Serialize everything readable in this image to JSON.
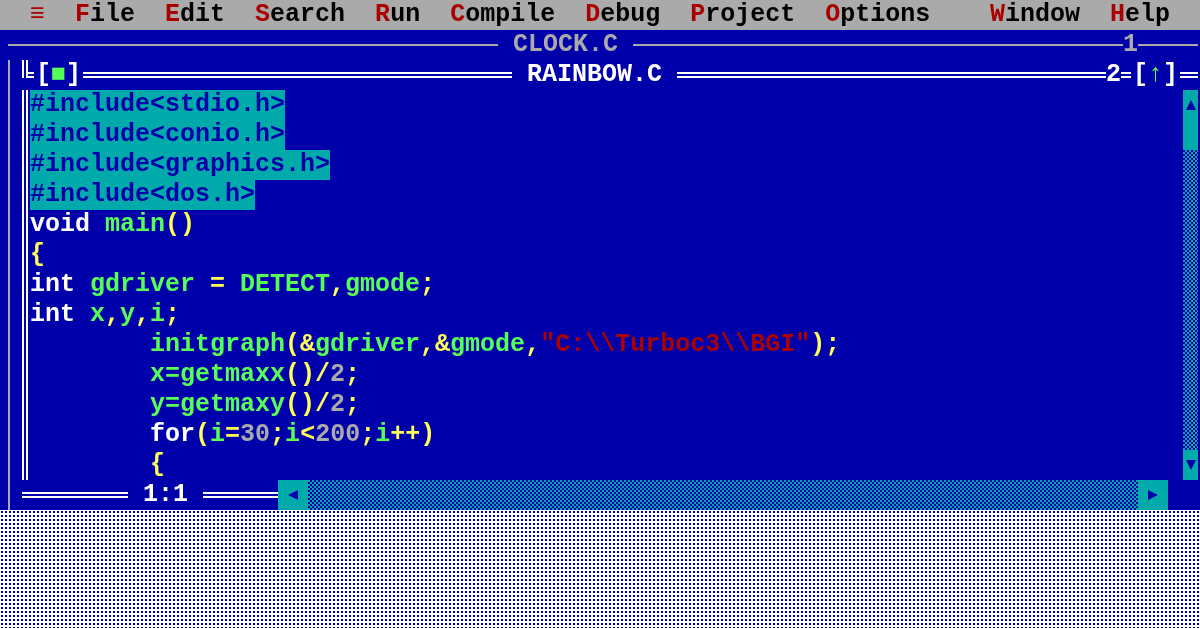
{
  "menu": [
    "≡",
    "File",
    "Edit",
    "Search",
    "Run",
    "Compile",
    "Debug",
    "Project",
    "Options",
    "Window",
    "Help"
  ],
  "windows": [
    {
      "title": "CLOCK.C",
      "number": "1",
      "active": false
    },
    {
      "title": "RAINBOW.C",
      "number": "2",
      "active": true,
      "close_box": "[■]",
      "zoom_box": "[↑]",
      "cursor_position": "1:1",
      "lines": [
        {
          "selected": true,
          "tokens": [
            {
              "kind": "preprocessor",
              "text": "#include<stdio.h>"
            }
          ]
        },
        {
          "selected": true,
          "tokens": [
            {
              "kind": "preprocessor",
              "text": "#include<conio.h>"
            }
          ]
        },
        {
          "selected": true,
          "tokens": [
            {
              "kind": "preprocessor",
              "text": "#include<graphics.h>"
            }
          ]
        },
        {
          "selected": true,
          "tokens": [
            {
              "kind": "preprocessor",
              "text": "#include<dos.h>"
            }
          ]
        },
        {
          "selected": false,
          "tokens": [
            {
              "kind": "keyword",
              "text": "void"
            },
            {
              "kind": "identifier",
              "text": " main"
            },
            {
              "kind": "symbol",
              "text": "()"
            }
          ]
        },
        {
          "selected": false,
          "tokens": [
            {
              "kind": "symbol",
              "text": "{"
            }
          ]
        },
        {
          "selected": false,
          "tokens": [
            {
              "kind": "keyword",
              "text": "int"
            },
            {
              "kind": "identifier",
              "text": " gdriver"
            },
            {
              "kind": "symbol",
              "text": " = "
            },
            {
              "kind": "identifier",
              "text": "DETECT"
            },
            {
              "kind": "symbol",
              "text": ","
            },
            {
              "kind": "identifier",
              "text": "gmode"
            },
            {
              "kind": "symbol",
              "text": ";"
            }
          ]
        },
        {
          "selected": false,
          "tokens": [
            {
              "kind": "keyword",
              "text": "int"
            },
            {
              "kind": "identifier",
              "text": " x"
            },
            {
              "kind": "symbol",
              "text": ","
            },
            {
              "kind": "identifier",
              "text": "y"
            },
            {
              "kind": "symbol",
              "text": ","
            },
            {
              "kind": "identifier",
              "text": "i"
            },
            {
              "kind": "symbol",
              "text": ";"
            }
          ]
        },
        {
          "selected": false,
          "tokens": [
            {
              "kind": "identifier",
              "text": "        initgraph"
            },
            {
              "kind": "symbol",
              "text": "(&"
            },
            {
              "kind": "identifier",
              "text": "gdriver"
            },
            {
              "kind": "symbol",
              "text": ",&"
            },
            {
              "kind": "identifier",
              "text": "gmode"
            },
            {
              "kind": "symbol",
              "text": ","
            },
            {
              "kind": "string",
              "text": "\"C:\\\\Turboc3\\\\BGI\""
            },
            {
              "kind": "symbol",
              "text": ");"
            }
          ]
        },
        {
          "selected": false,
          "tokens": [
            {
              "kind": "identifier",
              "text": "        x=getmaxx"
            },
            {
              "kind": "symbol",
              "text": "()/"
            },
            {
              "kind": "number",
              "text": "2"
            },
            {
              "kind": "symbol",
              "text": ";"
            }
          ]
        },
        {
          "selected": false,
          "tokens": [
            {
              "kind": "identifier",
              "text": "        y=getmaxy"
            },
            {
              "kind": "symbol",
              "text": "()/"
            },
            {
              "kind": "number",
              "text": "2"
            },
            {
              "kind": "symbol",
              "text": ";"
            }
          ]
        },
        {
          "selected": false,
          "tokens": [
            {
              "kind": "keyword",
              "text": "        for"
            },
            {
              "kind": "symbol",
              "text": "("
            },
            {
              "kind": "identifier",
              "text": "i"
            },
            {
              "kind": "symbol",
              "text": "="
            },
            {
              "kind": "number",
              "text": "30"
            },
            {
              "kind": "symbol",
              "text": ";"
            },
            {
              "kind": "identifier",
              "text": "i"
            },
            {
              "kind": "symbol",
              "text": "<"
            },
            {
              "kind": "number",
              "text": "200"
            },
            {
              "kind": "symbol",
              "text": ";"
            },
            {
              "kind": "identifier",
              "text": "i"
            },
            {
              "kind": "symbol",
              "text": "++)"
            }
          ]
        },
        {
          "selected": false,
          "tokens": [
            {
              "kind": "symbol",
              "text": "        {"
            }
          ]
        }
      ]
    }
  ]
}
